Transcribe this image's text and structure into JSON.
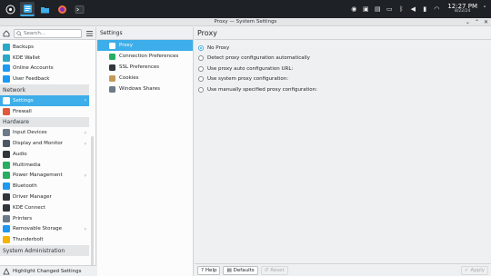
{
  "window": {
    "title": "Proxy — System Settings"
  },
  "taskbar": {
    "items": [
      "kde-launcher",
      "system-settings",
      "file-manager",
      "firefox",
      "terminal"
    ],
    "clock_time": "12:27 PM",
    "clock_date": "8/22/24"
  },
  "sidebar": {
    "search_placeholder": "Search...",
    "items_top": [
      {
        "label": "Backups",
        "color": "#2aa8c8"
      },
      {
        "label": "KDE Wallet",
        "color": "#2aa8c8"
      },
      {
        "label": "Online Accounts",
        "color": "#1d99f3"
      },
      {
        "label": "User Feedback",
        "color": "#1d99f3"
      }
    ],
    "network_header": "Network",
    "network_items": [
      {
        "label": "Settings",
        "color": "#3daee9",
        "selected": true,
        "chevron": true
      },
      {
        "label": "Firewall",
        "color": "#e05a3a"
      }
    ],
    "hardware_header": "Hardware",
    "hardware_items": [
      {
        "label": "Input Devices",
        "color": "#6c7a89",
        "chevron": true
      },
      {
        "label": "Display and Monitor",
        "color": "#4c5866",
        "chevron": true
      },
      {
        "label": "Audio",
        "color": "#31363b"
      },
      {
        "label": "Multimedia",
        "color": "#27ae60"
      },
      {
        "label": "Power Management",
        "color": "#27ae60",
        "chevron": true
      },
      {
        "label": "Bluetooth",
        "color": "#1d99f3"
      },
      {
        "label": "Driver Manager",
        "color": "#31363b"
      },
      {
        "label": "KDE Connect",
        "color": "#31363b"
      },
      {
        "label": "Printers",
        "color": "#6c7a89"
      },
      {
        "label": "Removable Storage",
        "color": "#1d99f3",
        "chevron": true
      },
      {
        "label": "Thunderbolt",
        "color": "#f4b400"
      }
    ],
    "sysadmin_header": "System Administration",
    "bottom_label": "Highlight Changed Settings"
  },
  "midcol": {
    "header": "Settings",
    "items": [
      {
        "label": "Proxy",
        "color": "#fcfcfc",
        "selected": true
      },
      {
        "label": "Connection Preferences",
        "color": "#27ae60"
      },
      {
        "label": "SSL Preferences",
        "color": "#31363b"
      },
      {
        "label": "Cookies",
        "color": "#c49a5a"
      },
      {
        "label": "Windows Shares",
        "color": "#6c7a89"
      }
    ]
  },
  "content": {
    "header": "Proxy",
    "options": [
      {
        "label": "No Proxy",
        "checked": true
      },
      {
        "label": "Detect proxy configuration automatically",
        "checked": false
      },
      {
        "label": "Use proxy auto configuration URL:",
        "checked": false
      },
      {
        "label": "Use system proxy configuration:",
        "checked": false
      },
      {
        "label": "Use manually specified proxy configuration:",
        "checked": false
      }
    ],
    "buttons": {
      "help": "Help",
      "defaults": "Defaults",
      "reset": "Reset",
      "apply": "Apply"
    }
  },
  "colors": {
    "accent": "#3daee9",
    "taskbar": "#1e2226"
  }
}
